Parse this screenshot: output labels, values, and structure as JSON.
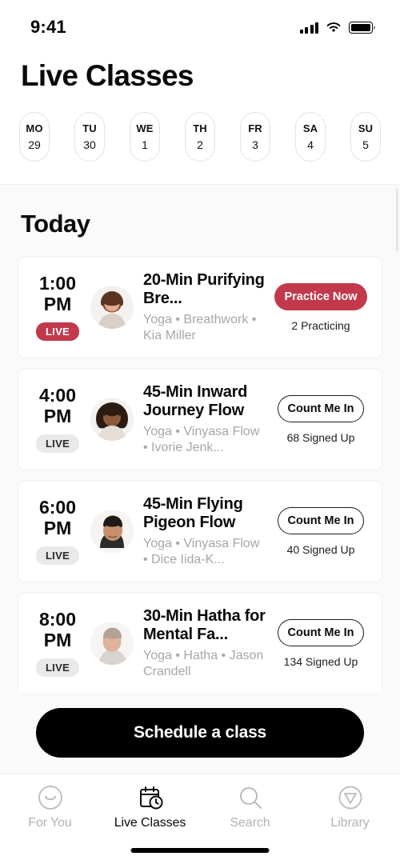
{
  "status_bar": {
    "time": "9:41",
    "signal_icon": "cellular-signal-icon",
    "wifi_icon": "wifi-icon",
    "battery_icon": "battery-icon"
  },
  "header": {
    "title": "Live Classes"
  },
  "day_picker": {
    "days": [
      {
        "dow": "MO",
        "num": "29"
      },
      {
        "dow": "TU",
        "num": "30"
      },
      {
        "dow": "WE",
        "num": "1"
      },
      {
        "dow": "TH",
        "num": "2"
      },
      {
        "dow": "FR",
        "num": "3"
      },
      {
        "dow": "SA",
        "num": "4"
      },
      {
        "dow": "SU",
        "num": "5"
      }
    ]
  },
  "schedule": {
    "section_title": "Today",
    "classes": [
      {
        "time": "1:00\nPM",
        "time_line1": "1:00",
        "time_line2": "PM",
        "badge": "LIVE",
        "badge_state": "active",
        "title": "20-Min Purifying Bre...",
        "meta": "Yoga • Breathwork • Kia Miller",
        "action_label": "Practice Now",
        "action_style": "primary",
        "count": "2 Practicing"
      },
      {
        "time_line1": "4:00",
        "time_line2": "PM",
        "badge": "LIVE",
        "badge_state": "inactive",
        "title": "45-Min Inward Journey Flow",
        "meta": "Yoga • Vinyasa Flow • Ivorie Jenk...",
        "action_label": "Count Me In",
        "action_style": "outline",
        "count": "68 Signed Up"
      },
      {
        "time_line1": "6:00",
        "time_line2": "PM",
        "badge": "LIVE",
        "badge_state": "inactive",
        "title": "45-Min Flying Pigeon Flow",
        "meta": "Yoga • Vinyasa Flow • Dice Iida-K...",
        "action_label": "Count Me In",
        "action_style": "outline",
        "count": "40 Signed Up"
      },
      {
        "time_line1": "8:00",
        "time_line2": "PM",
        "badge": "LIVE",
        "badge_state": "inactive",
        "title": "30-Min Hatha for Mental Fa...",
        "meta": "Yoga • Hatha • Jason Crandell",
        "action_label": "Count Me In",
        "action_style": "outline",
        "count": "134 Signed Up"
      }
    ]
  },
  "cta": {
    "label": "Schedule a class"
  },
  "tab_bar": {
    "tabs": [
      {
        "label": "For You",
        "icon": "smiley-face-icon",
        "active": false
      },
      {
        "label": "Live Classes",
        "icon": "calendar-clock-icon",
        "active": true
      },
      {
        "label": "Search",
        "icon": "search-icon",
        "active": false
      },
      {
        "label": "Library",
        "icon": "triangle-circle-icon",
        "active": false
      }
    ]
  },
  "colors": {
    "accent_red": "#C2394B",
    "cta_black": "#000000",
    "page_background": "#FBFAFB",
    "muted_text": "#A8A6A8"
  }
}
